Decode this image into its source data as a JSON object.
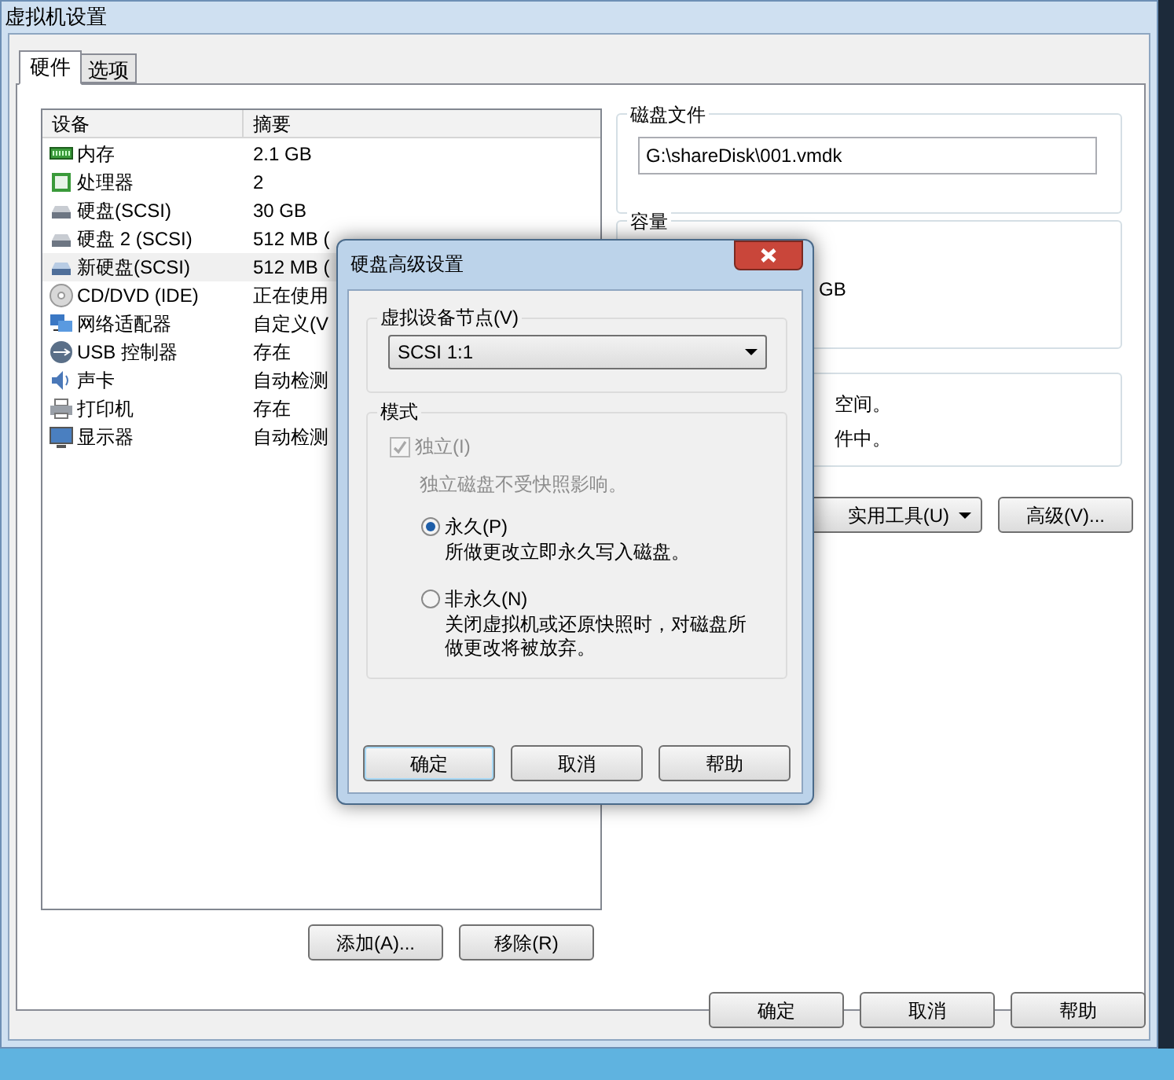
{
  "window": {
    "title": "虚拟机设置"
  },
  "tabs": [
    {
      "label": "硬件",
      "selected": true
    },
    {
      "label": "选项",
      "selected": false
    }
  ],
  "device_table": {
    "columns": [
      "设备",
      "摘要"
    ],
    "rows": [
      {
        "device": "内存",
        "summary": "2.1 GB",
        "selected": false
      },
      {
        "device": "处理器",
        "summary": "2",
        "selected": false
      },
      {
        "device": "硬盘(SCSI)",
        "summary": "30 GB",
        "selected": false
      },
      {
        "device": "硬盘 2 (SCSI)",
        "summary": "512 MB (",
        "selected": false
      },
      {
        "device": "新硬盘(SCSI)",
        "summary": "512 MB (",
        "selected": true
      },
      {
        "device": "CD/DVD (IDE)",
        "summary": "正在使用",
        "selected": false
      },
      {
        "device": "网络适配器",
        "summary": "自定义(V",
        "selected": false
      },
      {
        "device": "USB 控制器",
        "summary": "存在",
        "selected": false
      },
      {
        "device": "声卡",
        "summary": "自动检测",
        "selected": false
      },
      {
        "device": "打印机",
        "summary": "存在",
        "selected": false
      },
      {
        "device": "显示器",
        "summary": "自动检测",
        "selected": false
      }
    ]
  },
  "list_buttons": [
    "添加(A)...",
    "移除(R)"
  ],
  "disk_file": {
    "title": "磁盘文件",
    "value": "G:\\shareDisk\\001.vmdk"
  },
  "capacity": {
    "title": "容量",
    "unit_fragment": "GB"
  },
  "disk_info_fragments": [
    "空间。",
    "件中。"
  ],
  "disk_buttons": [
    {
      "label": "实用工具(U)",
      "kind": "dropdown"
    },
    {
      "label": "高级(V)...",
      "kind": "plain"
    }
  ],
  "footer_buttons": [
    "确定",
    "取消",
    "帮助"
  ],
  "dialog": {
    "title": "硬盘高级设置",
    "node_group": {
      "title": "虚拟设备节点(V)",
      "value": "SCSI 1:1"
    },
    "mode_group": {
      "title": "模式",
      "independent": {
        "label": "独立(I)",
        "checked": true,
        "disabled": true
      },
      "note": "独立磁盘不受快照影响。",
      "options": [
        {
          "label": "永久(P)",
          "description": "所做更改立即永久写入磁盘。",
          "selected": true
        },
        {
          "label": "非永久(N)",
          "description": "关闭虚拟机或还原快照时，对磁盘所做更改将被放弃。",
          "selected": false
        }
      ]
    },
    "buttons": [
      {
        "label": "确定",
        "default": true
      },
      {
        "label": "取消",
        "default": false
      },
      {
        "label": "帮助",
        "default": false
      }
    ]
  }
}
